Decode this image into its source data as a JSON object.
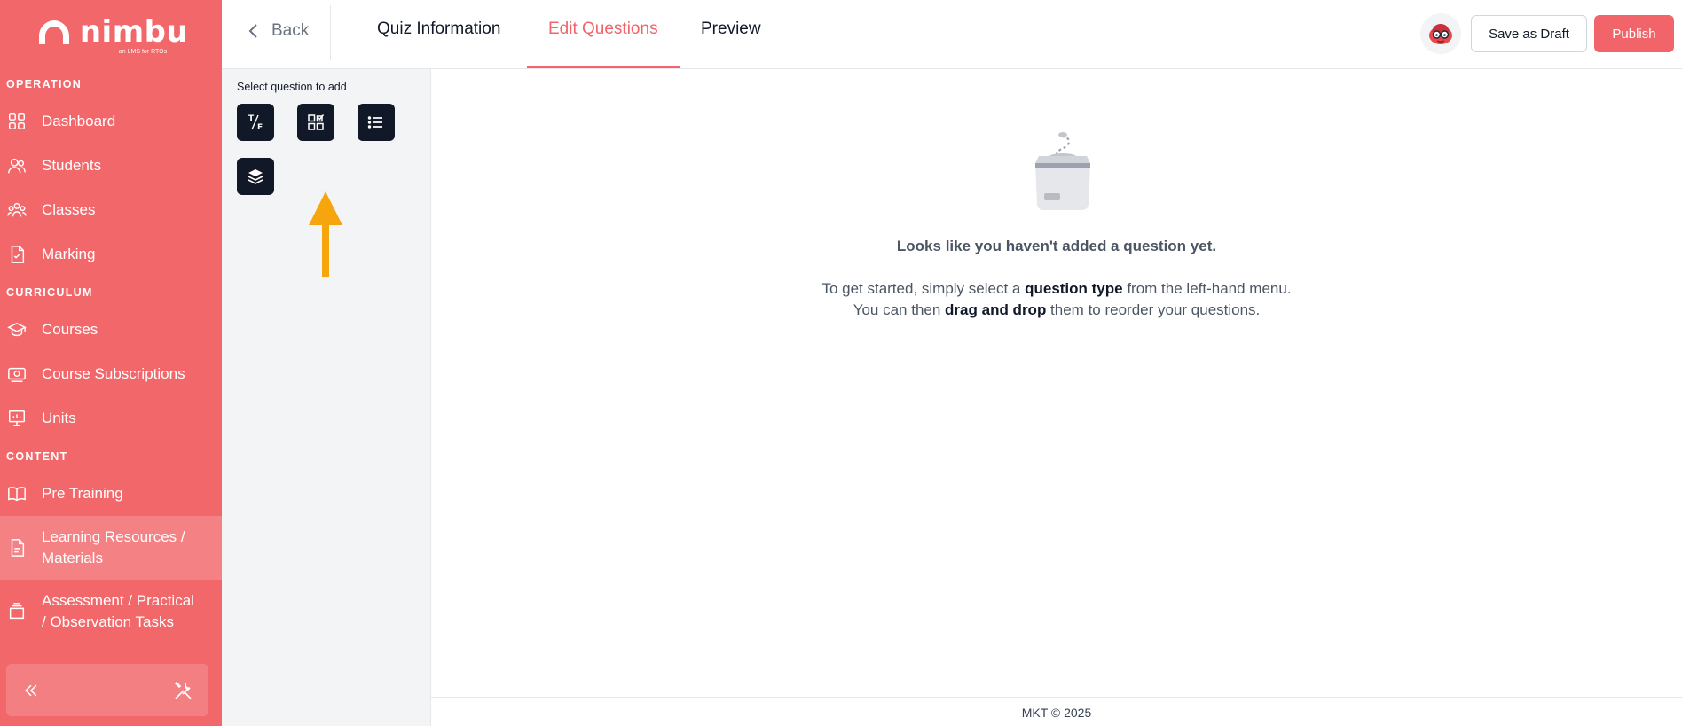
{
  "brand": {
    "name": "nimbu",
    "tagline": "an LMS for RTOs",
    "accent": "#f2676a"
  },
  "sidebar": {
    "sections": [
      {
        "label": "OPERATION",
        "items": [
          {
            "label": "Dashboard",
            "icon": "dashboard-icon"
          },
          {
            "label": "Students",
            "icon": "students-icon"
          },
          {
            "label": "Classes",
            "icon": "classes-icon"
          },
          {
            "label": "Marking",
            "icon": "marking-icon"
          }
        ]
      },
      {
        "label": "CURRICULUM",
        "items": [
          {
            "label": "Courses",
            "icon": "courses-icon"
          },
          {
            "label": "Course Subscriptions",
            "icon": "course-subscriptions-icon"
          },
          {
            "label": "Units",
            "icon": "units-icon"
          }
        ]
      },
      {
        "label": "CONTENT",
        "items": [
          {
            "label": "Pre Training",
            "icon": "book-icon"
          },
          {
            "label": "Learning Resources / Materials",
            "icon": "document-icon",
            "active": true
          },
          {
            "label": "Assessment / Practical / Observation Tasks",
            "icon": "tasks-icon"
          }
        ]
      }
    ],
    "footer": {
      "collapse_icon": "double-chevron-left-icon",
      "tools_icon": "tools-icon"
    }
  },
  "header": {
    "back_label": "Back",
    "tabs": [
      {
        "label": "Quiz Information",
        "active": false
      },
      {
        "label": "Edit Questions",
        "active": true
      },
      {
        "label": "Preview",
        "active": false
      }
    ],
    "save_draft_label": "Save as Draft",
    "publish_label": "Publish"
  },
  "question_panel": {
    "title": "Select question to add",
    "types": [
      {
        "icon": "true-false-icon",
        "glyph_top": "T",
        "glyph_bottom": "F"
      },
      {
        "icon": "multiple-choice-icon"
      },
      {
        "icon": "list-icon"
      },
      {
        "icon": "layers-icon"
      }
    ]
  },
  "empty_state": {
    "heading": "Looks like you haven't added a question yet.",
    "line1_pre": "To get started, simply select a ",
    "line1_bold": "question type",
    "line1_post": " from the left-hand menu.",
    "line2_pre": "You can then ",
    "line2_bold": "drag and drop",
    "line2_post": " them to reorder your questions."
  },
  "footer": {
    "text": "MKT © 2025"
  }
}
